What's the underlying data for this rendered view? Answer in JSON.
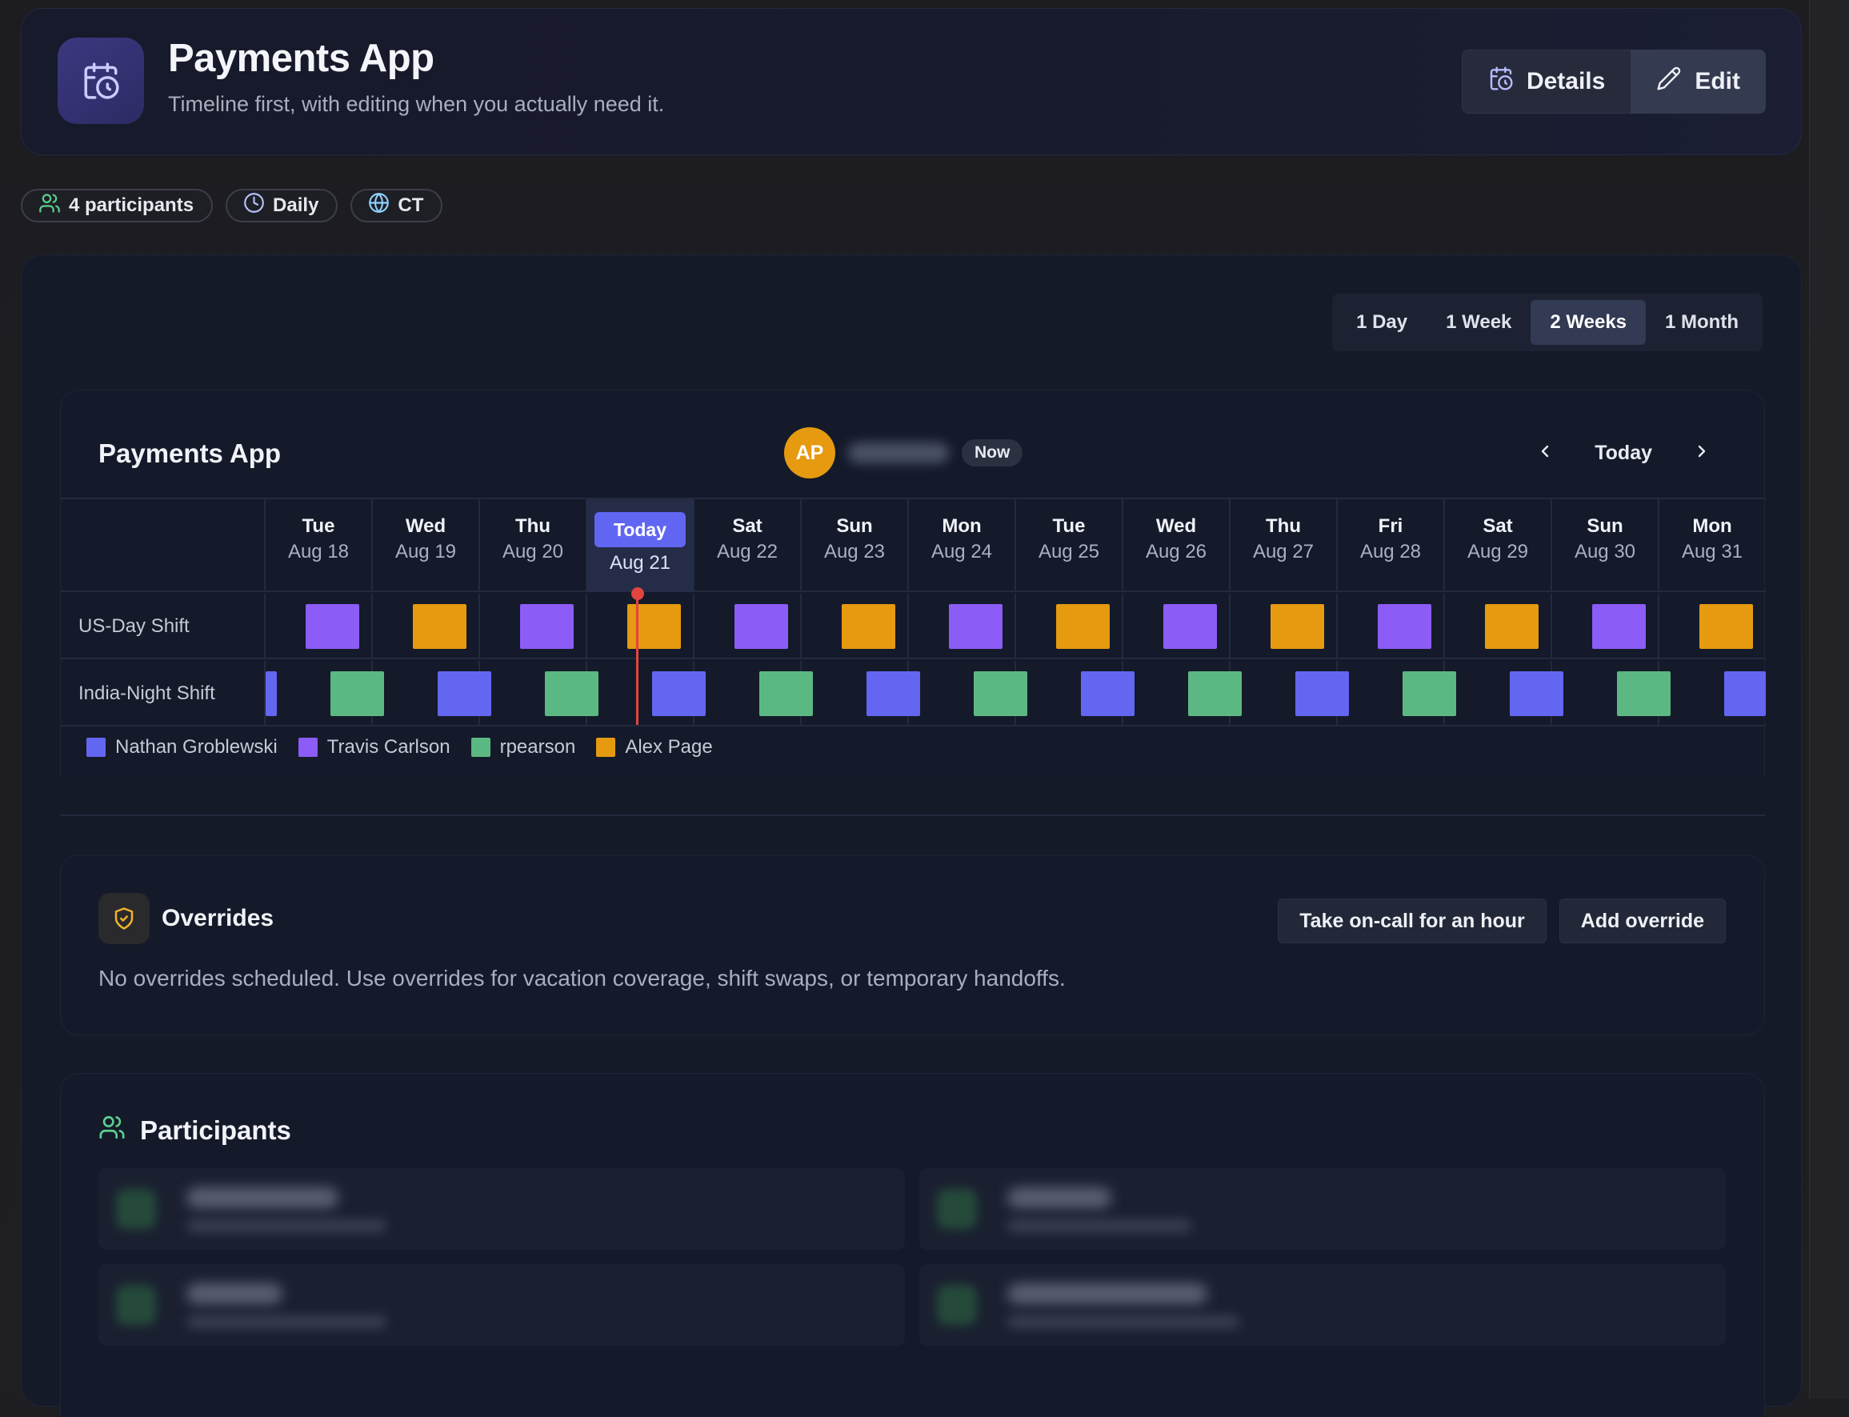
{
  "header": {
    "title": "Payments App",
    "subtitle": "Timeline first, with editing when you actually need it.",
    "details_label": "Details",
    "edit_label": "Edit"
  },
  "chips": [
    {
      "icon": "users-icon",
      "label": "4 participants"
    },
    {
      "icon": "clock-icon",
      "label": "Daily"
    },
    {
      "icon": "globe-icon",
      "label": "CT"
    }
  ],
  "range_tabs": [
    "1 Day",
    "1 Week",
    "2 Weeks",
    "1 Month"
  ],
  "active_range": "2 Weeks",
  "schedule": {
    "title": "Payments App",
    "oncall_initials": "AP",
    "now_label": "Now",
    "today_label": "Today",
    "days": [
      {
        "name": "Tue",
        "date": "Aug 18"
      },
      {
        "name": "Wed",
        "date": "Aug 19"
      },
      {
        "name": "Thu",
        "date": "Aug 20"
      },
      {
        "name": "Today",
        "date": "Aug 21",
        "today": true
      },
      {
        "name": "Sat",
        "date": "Aug 22"
      },
      {
        "name": "Sun",
        "date": "Aug 23"
      },
      {
        "name": "Mon",
        "date": "Aug 24"
      },
      {
        "name": "Tue",
        "date": "Aug 25"
      },
      {
        "name": "Wed",
        "date": "Aug 26"
      },
      {
        "name": "Thu",
        "date": "Aug 27"
      },
      {
        "name": "Fri",
        "date": "Aug 28"
      },
      {
        "name": "Sat",
        "date": "Aug 29"
      },
      {
        "name": "Sun",
        "date": "Aug 30"
      },
      {
        "name": "Mon",
        "date": "Aug 31"
      }
    ],
    "rows": [
      {
        "label": "US-Day Shift",
        "pattern": [
          "Travis Carlson",
          "Alex Page"
        ]
      },
      {
        "label": "India-Night Shift",
        "pattern": [
          "Nathan Groblewski",
          "rpearson"
        ]
      }
    ],
    "legend": [
      {
        "name": "Nathan Groblewski",
        "color": "#6366f1"
      },
      {
        "name": "Travis Carlson",
        "color": "#8b5cf6"
      },
      {
        "name": "rpearson",
        "color": "#5cb882"
      },
      {
        "name": "Alex Page",
        "color": "#e59a10"
      }
    ]
  },
  "overrides": {
    "title": "Overrides",
    "take_oncall_label": "Take on-call for an hour",
    "add_override_label": "Add override",
    "empty_text": "No overrides scheduled. Use overrides for vacation coverage, shift swaps, or temporary handoffs."
  },
  "participants": {
    "title": "Participants"
  },
  "colors": {
    "accent": "#6166f2",
    "now_line": "#e2453f"
  }
}
